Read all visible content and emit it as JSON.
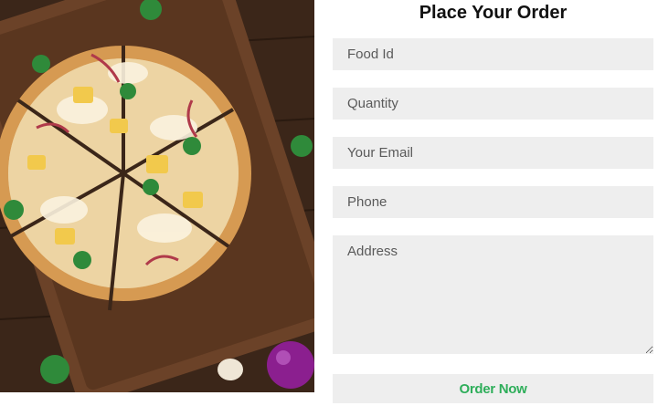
{
  "form": {
    "title": "Place Your Order",
    "fields": {
      "food_id": {
        "placeholder": "Food Id",
        "value": ""
      },
      "quantity": {
        "placeholder": "Quantity",
        "value": ""
      },
      "email": {
        "placeholder": "Your Email",
        "value": ""
      },
      "phone": {
        "placeholder": "Phone",
        "value": ""
      },
      "address": {
        "placeholder": "Address",
        "value": ""
      }
    },
    "submit_label": "Order Now"
  },
  "colors": {
    "field_bg": "#eeeeee",
    "submit_text": "#2eae5a",
    "title_text": "#111111"
  },
  "image": {
    "subject": "pizza-on-wooden-board"
  }
}
